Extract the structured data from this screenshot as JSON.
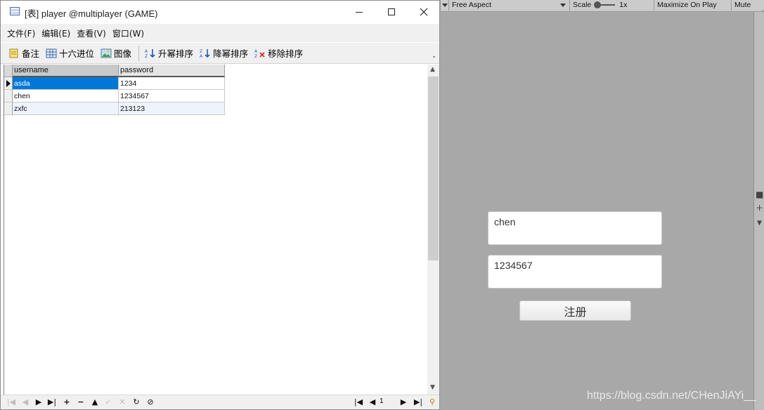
{
  "window": {
    "title": "[表] player @multiplayer (GAME)"
  },
  "menu": [
    "文件(F)",
    "编辑(E)",
    "查看(V)",
    "窗口(W)"
  ],
  "toolbar": {
    "memo_label": "备注",
    "hex_label": "十六进位",
    "image_label": "图像",
    "sort_asc_label": "升幂排序",
    "sort_desc_label": "降幂排序",
    "remove_sort_label": "移除排序"
  },
  "table": {
    "columns": [
      "username",
      "password"
    ],
    "rows": [
      {
        "username": "asda",
        "password": "1234"
      },
      {
        "username": "chen",
        "password": "1234567"
      },
      {
        "username": "zxfc",
        "password": "213123"
      }
    ]
  },
  "pager": {
    "page": "1"
  },
  "unity": {
    "aspect_label": "Free Aspect",
    "scale_label": "Scale",
    "scale_value": "1x",
    "maximize_label": "Maximize On Play",
    "mute_label": "Mute",
    "username_value": "chen",
    "password_value": "1234567",
    "register_label": "注册"
  },
  "watermark": "https://blog.csdn.net/CHenJiAYi__",
  "colors": {
    "selection": "#0078d7",
    "unity_bg": "#a8a8a8",
    "window_chrome": "#f0f0f0"
  }
}
